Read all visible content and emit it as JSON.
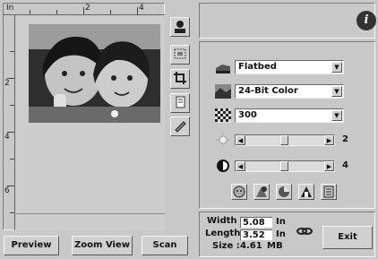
{
  "preview": {
    "ruler_unit": "In",
    "ruler_top_marks": [
      "2",
      "4"
    ],
    "ruler_left_marks": [
      "2",
      "4",
      "6"
    ]
  },
  "tools": {
    "icons": [
      "portrait-icon",
      "auto-crop-icon",
      "crop-icon",
      "copy-icon",
      "pen-icon"
    ]
  },
  "info_label": "i",
  "settings": {
    "scan_source": "Flatbed",
    "scan_mode": "24-Bit Color",
    "resolution": "300",
    "brightness": {
      "value": "2",
      "level": 0.5
    },
    "contrast": {
      "value": "4",
      "level": 0.5
    }
  },
  "size": {
    "width_label": "Width :",
    "width_value": "5.08",
    "length_label": "Length :",
    "length_value": "3.52",
    "unit": "In",
    "size_label": "Size :",
    "size_value": "4.61",
    "size_unit": "MB"
  },
  "buttons": {
    "preview": "Preview",
    "zoom_view": "Zoom View",
    "scan": "Scan",
    "exit": "Exit"
  }
}
